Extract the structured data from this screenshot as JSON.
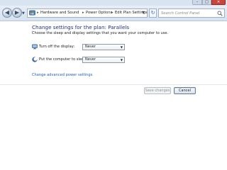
{
  "window": {
    "minimize_glyph": "–",
    "maximize_glyph": "□",
    "close_glyph": "✕"
  },
  "navigation": {
    "back_glyph": "◀",
    "forward_glyph": "▶",
    "recent_glyph": "▼",
    "refresh_glyph": "↻"
  },
  "breadcrumb": {
    "separator": "▸",
    "items": [
      "Hardware and Sound",
      "Power Options",
      "Edit Plan Settings"
    ]
  },
  "search": {
    "placeholder": "Search Control Panel",
    "value": ""
  },
  "main": {
    "heading": "Change settings for the plan: Parallels",
    "description": "Choose the sleep and display settings that you want your computer to use.",
    "settings": [
      {
        "label": "Turn off the display:",
        "value": "Never",
        "icon": "monitor-icon"
      },
      {
        "label": "Put the computer to sleep:",
        "value": "Never",
        "icon": "moon-sleep-icon"
      }
    ],
    "advanced_link": "Change advanced power settings"
  },
  "buttons": {
    "save": "Save changes",
    "cancel": "Cancel"
  },
  "colors": {
    "heading": "#1e3287",
    "link": "#1e5fb4",
    "close_button": "#c9463d"
  }
}
